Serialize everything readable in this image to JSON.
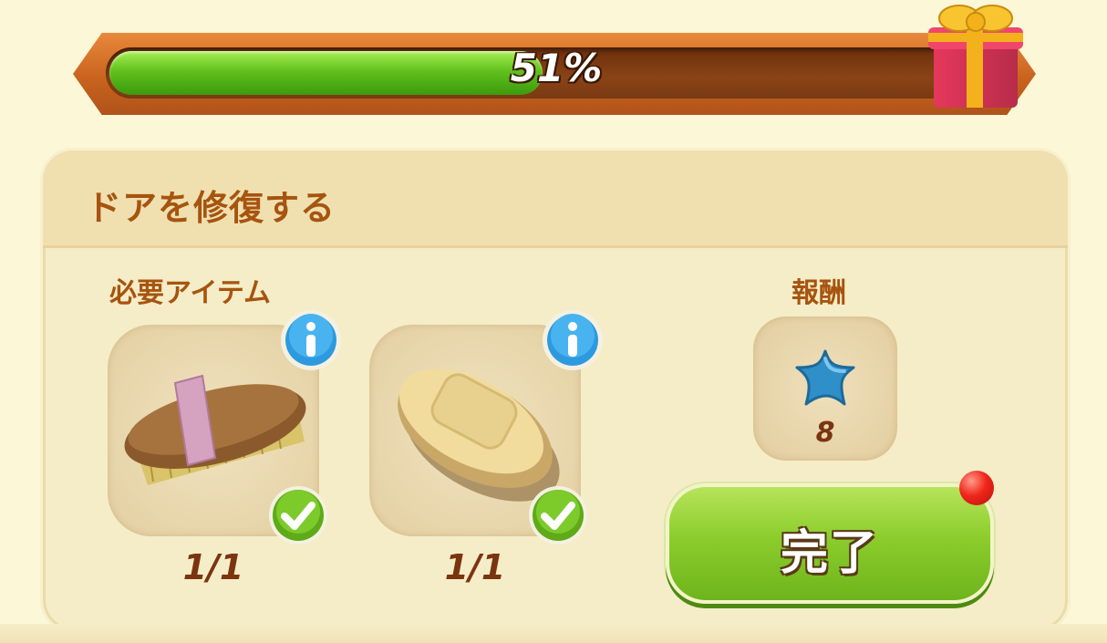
{
  "progress": {
    "percent": 51,
    "label": "51%"
  },
  "task": {
    "title": "ドアを修復する",
    "required_label": "必要アイテム",
    "reward_label": "報酬",
    "items": [
      {
        "name": "brush",
        "count": "1/1",
        "completed": true
      },
      {
        "name": "soap",
        "count": "1/1",
        "completed": true
      }
    ],
    "reward": {
      "icon": "blue-star-icon",
      "amount": "8"
    },
    "done_label": "完了",
    "has_notification": true
  },
  "colors": {
    "accent_text": "#a6540f",
    "progress_green": "#62c11c",
    "button_green": "#8ccd2c",
    "notification_red": "#f0261a"
  }
}
